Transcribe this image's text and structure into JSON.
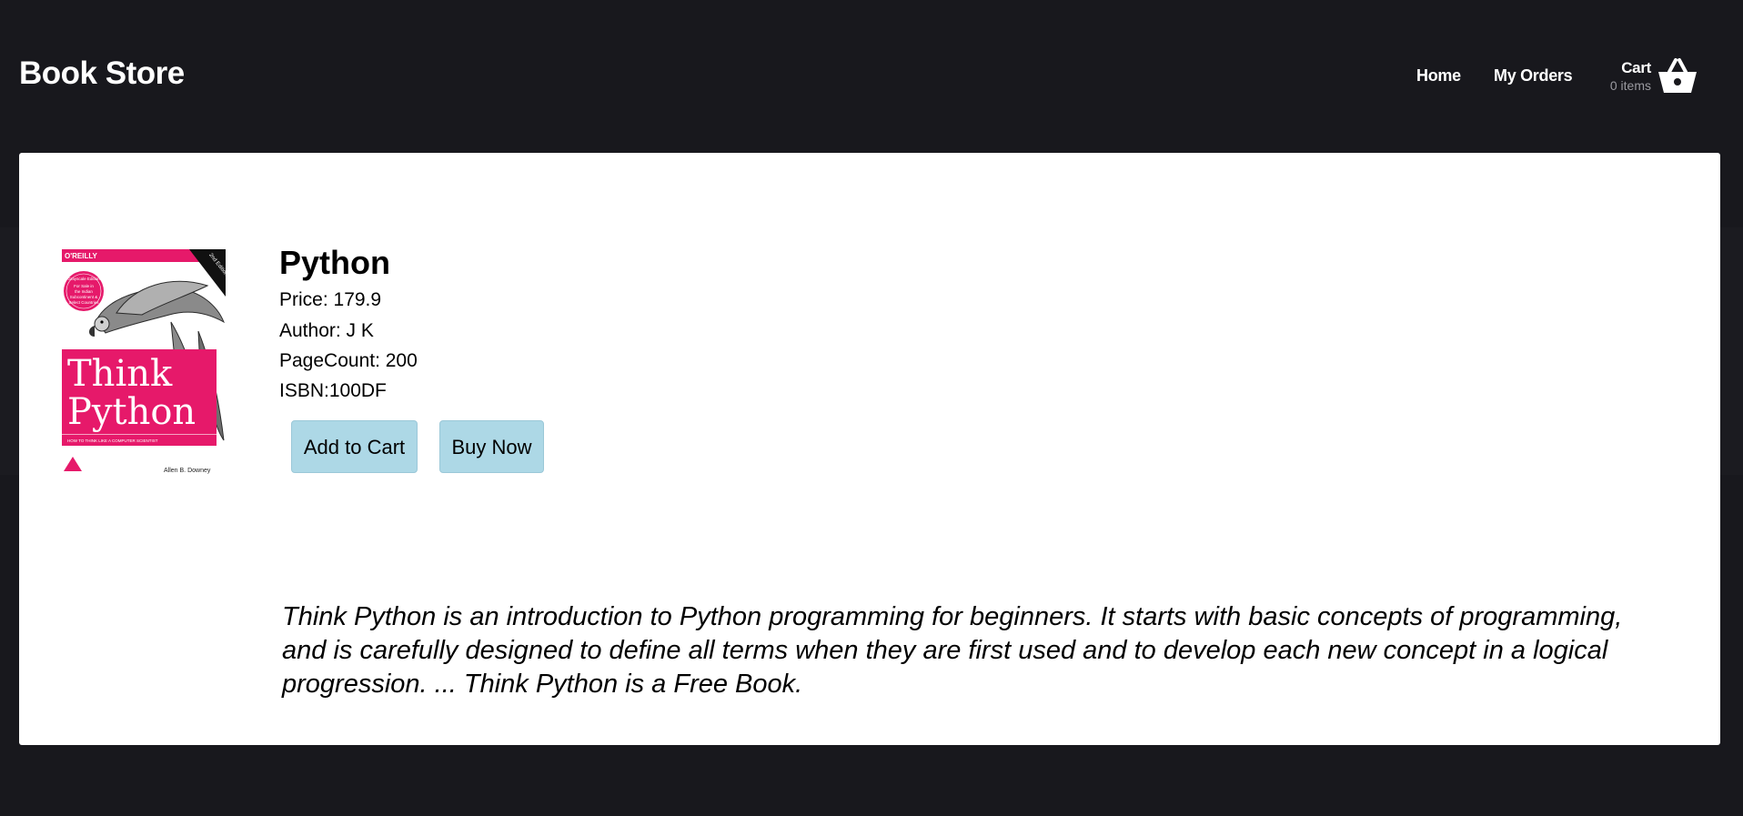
{
  "header": {
    "brand": "Book Store",
    "nav": {
      "home": "Home",
      "orders": "My Orders"
    },
    "cart": {
      "label": "Cart",
      "count": "0 items",
      "icon": "basket-icon"
    }
  },
  "book": {
    "cover": {
      "publisher": "O'REILLY",
      "edition": "2nd Edition",
      "title_line1": "Think",
      "title_line2": "Python",
      "author": "Allen B. Downey",
      "tagline": "HOW TO THINK LIKE A COMPUTER SCIENTIST",
      "badge": "Grayscale Edition For Sale in the Indian Subcontinent & Select Countries Only*",
      "accent_color": "#e6196a"
    },
    "title": "Python",
    "price": "Price: 179.9",
    "author": "Author: J K",
    "page_count": "PageCount: 200",
    "isbn": "ISBN:100DF",
    "description": "Think Python is an introduction to Python programming for beginners. It starts with basic concepts of programming, and is carefully designed to define all terms when they are first used and to develop each new concept in a logical progression. ... Think Python is a Free Book."
  },
  "actions": {
    "add_to_cart": "Add to Cart",
    "buy_now": "Buy Now",
    "button_color": "#add8e6"
  }
}
